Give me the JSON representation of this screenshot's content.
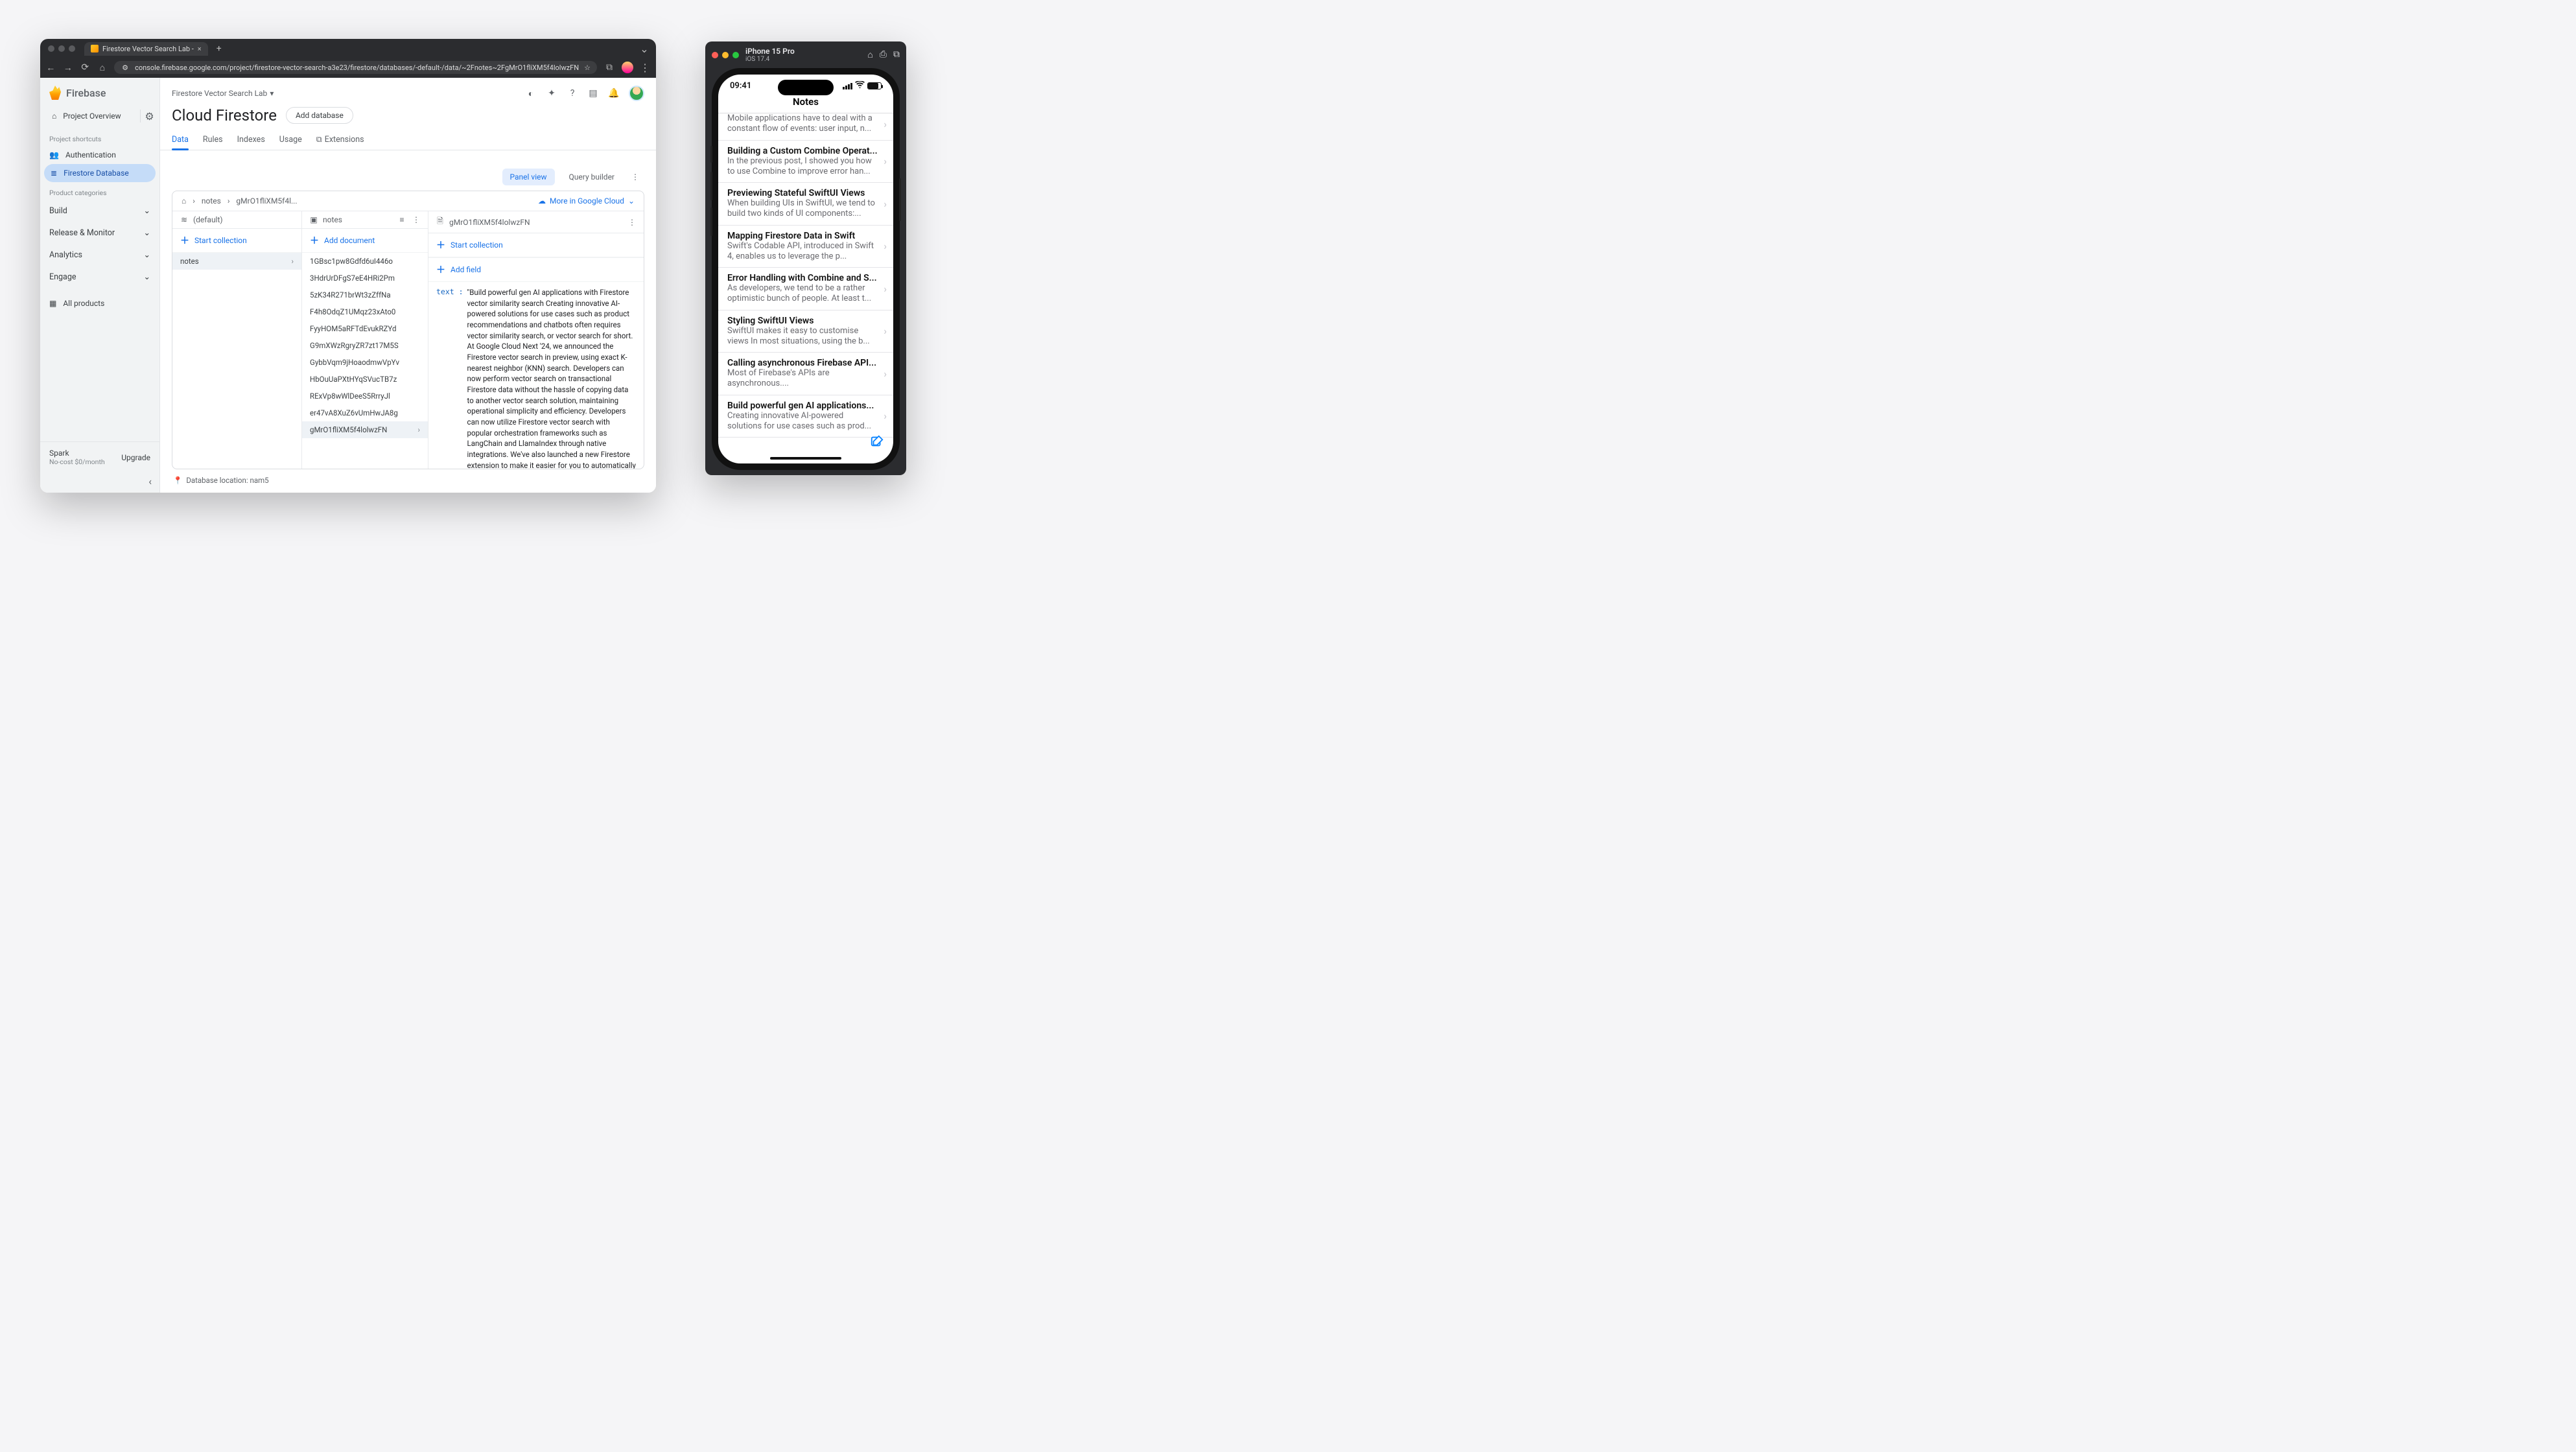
{
  "chrome": {
    "tab_title": "Firestore Vector Search Lab - ",
    "url": "console.firebase.google.com/project/firestore-vector-search-a3e23/firestore/databases/-default-/data/~2Fnotes~2FgMrO1fliXM5f4lolwzFN"
  },
  "firebase": {
    "brand": "Firebase",
    "project_name": "Firestore Vector Search Lab",
    "page_title": "Cloud Firestore",
    "add_database_label": "Add database",
    "sidebar": {
      "overview": "Project Overview",
      "shortcuts_label": "Project shortcuts",
      "auth": "Authentication",
      "firestore": "Firestore Database",
      "categories_label": "Product categories",
      "groups": [
        "Build",
        "Release & Monitor",
        "Analytics",
        "Engage"
      ],
      "all_products": "All products",
      "spark_title": "Spark",
      "spark_sub": "No-cost $0/month",
      "upgrade": "Upgrade"
    },
    "tabs": [
      "Data",
      "Rules",
      "Indexes",
      "Usage",
      "Extensions"
    ],
    "toolbar": {
      "panel_view": "Panel view",
      "query_builder": "Query builder"
    },
    "breadcrumbs": {
      "collection": "notes",
      "doc": "gMrO1fliXM5f4l..."
    },
    "more_in_cloud": "More in Google Cloud",
    "col1": {
      "header": "(default)",
      "start": "Start collection",
      "items": [
        "notes"
      ]
    },
    "col2": {
      "header": "notes",
      "start": "Add document",
      "items": [
        "1GBsc1pw8Gdfd6uI446o",
        "3HdrUrDFgS7eE4HRi2Pm",
        "5zK34R271brWt3zZffNa",
        "F4h8OdqZ1UMqz23xAto0",
        "FyyHOM5aRFTdEvukRZYd",
        "G9mXWzRgryZR7zt17M5S",
        "GybbVqm9jHoaodmwVpYv",
        "HbOuUaPXtHYqSVucTB7z",
        "RExVp8wWlDeeS5RrryJl",
        "er47vA8XuZ6vUmHwJA8g",
        "gMrO1fliXM5f4lolwzFN"
      ],
      "selected": "gMrO1fliXM5f4lolwzFN"
    },
    "col3": {
      "header": "gMrO1fliXM5f4lolwzFN",
      "start": "Start collection",
      "add_field": "Add field",
      "field_key": "text :",
      "field_value": "\"Build powerful gen AI applications with Firestore vector similarity search Creating innovative AI-powered solutions for use cases such as product recommendations and chatbots often requires vector similarity search, or vector search for short. At Google Cloud Next '24, we announced the Firestore vector search in preview, using exact K-nearest neighbor (KNN) search. Developers can now perform vector search on transactional Firestore data without the hassle of copying data to another vector search solution, maintaining operational simplicity and efficiency. Developers can now utilize Firestore vector search with popular orchestration frameworks such as LangChain and LlamaIndex through native integrations. We've also launched a new Firestore extension to make it easier for you to automatically compute vector embeddings on your data, and create web services that make it easier for you to perform vector searches from a web or mobile application. In this blog, we'll discuss how developers can get started with Firestore's new vector search capabilities.\""
    },
    "footer_location": "Database location: nam5"
  },
  "simulator": {
    "device": "iPhone 15 Pro",
    "os": "iOS 17.4",
    "time": "09:41",
    "nav_title": "Notes",
    "notes": [
      {
        "title": "",
        "sub": "Mobile applications have to deal with a constant flow of events: user input, n..."
      },
      {
        "title": "Building a Custom Combine Operat...",
        "sub": "In the previous post, I showed you how to use Combine to improve error han..."
      },
      {
        "title": "Previewing Stateful SwiftUI Views",
        "sub": "When building UIs in SwiftUI, we tend to build two kinds of UI components:..."
      },
      {
        "title": "Mapping Firestore Data in Swift",
        "sub": "Swift's Codable API, introduced in Swift 4, enables us to leverage the p..."
      },
      {
        "title": "Error Handling with Combine and S...",
        "sub": "As developers, we tend to be a rather optimistic bunch of people. At least t..."
      },
      {
        "title": "Styling SwiftUI Views",
        "sub": "SwiftUI makes it easy to customise views In most situations, using the b..."
      },
      {
        "title": "Calling asynchronous Firebase API...",
        "sub": "Most of Firebase's APIs are asynchronous...."
      },
      {
        "title": "Build powerful gen AI applications...",
        "sub": "Creating innovative AI-powered solutions for use cases such as prod..."
      }
    ]
  }
}
